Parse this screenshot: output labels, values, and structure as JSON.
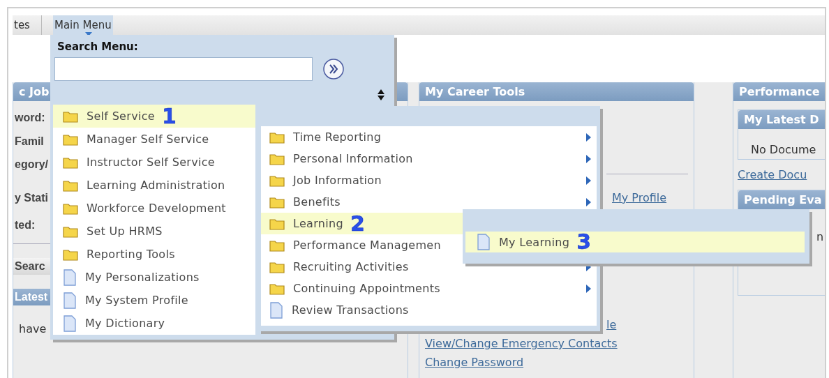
{
  "nav": {
    "tabs": [
      {
        "label": "tes",
        "selected": false
      },
      {
        "label": "Main Menu",
        "selected": true
      }
    ]
  },
  "left_panel": {
    "title": "c Job",
    "labels": [
      "word:",
      "Famil",
      "egory/",
      "y Stati",
      "ted:"
    ],
    "search_header": "Searc",
    "latest_header": "Latest",
    "text": "have"
  },
  "career_tools": {
    "title": "My Career Tools",
    "links": [
      "My Profile",
      "le",
      "View/Change Emergency Contacts",
      "Change Password"
    ]
  },
  "performance": {
    "title": "Performance",
    "documents": {
      "title": "My Latest D",
      "text": "No Docume"
    },
    "link": "Create Docu",
    "pending": {
      "title": "Pending Eva",
      "text": "n"
    }
  },
  "main_menu": {
    "search_label": "Search Menu:",
    "items": [
      {
        "label": "Self Service",
        "kind": "folder",
        "selected": true,
        "callout": "1"
      },
      {
        "label": "Manager Self Service",
        "kind": "folder",
        "selected": false
      },
      {
        "label": "Instructor Self Service",
        "kind": "folder",
        "selected": false
      },
      {
        "label": "Learning Administration",
        "kind": "folder",
        "selected": false
      },
      {
        "label": "Workforce Development",
        "kind": "folder",
        "selected": false
      },
      {
        "label": "Set Up HRMS",
        "kind": "folder",
        "selected": false
      },
      {
        "label": "Reporting Tools",
        "kind": "folder",
        "selected": false
      },
      {
        "label": "My Personalizations",
        "kind": "page",
        "selected": false
      },
      {
        "label": "My System Profile",
        "kind": "page",
        "selected": false
      },
      {
        "label": "My Dictionary",
        "kind": "page",
        "selected": false
      }
    ]
  },
  "submenu": {
    "items": [
      {
        "label": "Time Reporting",
        "kind": "folder",
        "selected": false,
        "arrow": true
      },
      {
        "label": "Personal Information",
        "kind": "folder",
        "selected": false,
        "arrow": true
      },
      {
        "label": "Job Information",
        "kind": "folder",
        "selected": false,
        "arrow": true
      },
      {
        "label": "Benefits",
        "kind": "folder",
        "selected": false,
        "arrow": true
      },
      {
        "label": "Learning",
        "kind": "folder",
        "selected": true,
        "callout": "2",
        "arrow": false
      },
      {
        "label": "Performance Managemen",
        "kind": "folder",
        "selected": false,
        "arrow": false
      },
      {
        "label": "Recruiting Activities",
        "kind": "folder",
        "selected": false,
        "arrow": true
      },
      {
        "label": "Continuing Appointments",
        "kind": "folder",
        "selected": false,
        "arrow": true
      },
      {
        "label": "Review Transactions",
        "kind": "page",
        "selected": false,
        "arrow": false
      }
    ]
  },
  "submenu_2": {
    "items": [
      {
        "label": "My Learning",
        "kind": "page",
        "selected": true,
        "callout": "3"
      }
    ]
  }
}
